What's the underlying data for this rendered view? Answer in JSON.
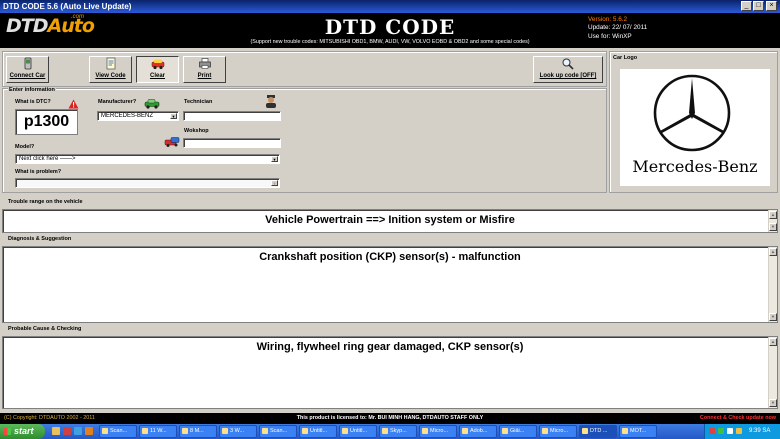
{
  "window": {
    "title": "DTD CODE 5.6 (Auto Live Update)",
    "minimize": "_",
    "maximize": "□",
    "close": "×"
  },
  "header": {
    "logo_part1": "DTD",
    "logo_part2": "Auto",
    "logo_com": ".com",
    "title": "DTD CODE",
    "subtitle": "(Support new trouble codes: MITSUBISHI OBD1, BMW, AUDI, VW, VOLVO EOBD & OBD2 and some special codes)",
    "version": "Version: 5.6.2",
    "update": "Update: 22/ 07/ 2011",
    "use_for": "Use for: WinXP"
  },
  "toolbar": {
    "connect_car": "Connect Car",
    "view_code": "View Code",
    "clear": "Clear",
    "print": "Print",
    "look_up_code": "Look up code [OFF]"
  },
  "car_logo": {
    "label": "Car Logo",
    "brand_text": "Mercedes-Benz"
  },
  "enter_info": {
    "label": "Enter information",
    "dtc_label": "What is DTC?",
    "dtc_value": "p1300",
    "manufacturer_label": "Manufacturer?",
    "manufacturer_value": "MERCEDES-BENZ",
    "technician_label": "Technician",
    "technician_value": "",
    "workshop_label": "Wokshop",
    "workshop_value": "",
    "model_label": "Model?",
    "model_value": "Next click here  ——>",
    "problem_label": "What is problem?",
    "problem_value": ""
  },
  "trouble_range": {
    "label": "Trouble range on the vehicle",
    "text": "Vehicle Powertrain ==>  Inition system or Misfire"
  },
  "diagnosis": {
    "label": "Diagnosis & Suggestion",
    "text": "Crankshaft position (CKP) sensor(s) - malfunction"
  },
  "probable_cause": {
    "label": "Probable Cause & Checking",
    "text": "Wiring, flywheel ring gear damaged, CKP sensor(s)"
  },
  "footer": {
    "copyright": "(C) Copyright: DTDAUTO  2002 - 2011",
    "license": "This product is licensed to: Mr. BUI MINH HANG, DTDAUTO STAFF ONLY",
    "right": "Connect & Check update now"
  },
  "taskbar": {
    "start": "start",
    "tasks": [
      "Scan...",
      "11 W...",
      "8 M...",
      "3 W...",
      "Scan...",
      "Untitl...",
      "Untitl...",
      "Skyp...",
      "Micro...",
      "Adob...",
      "Giải...",
      "Micro...",
      "DTD ...",
      "MOT..."
    ],
    "clock": "9:39 SA"
  },
  "colors": {
    "titlebar": "#0a246a",
    "accent_orange": "#f0a000",
    "version_orange": "#ff8000",
    "footer_red": "#ff3030",
    "footer_gold": "#d8b040",
    "face": "#d4d0c8"
  }
}
